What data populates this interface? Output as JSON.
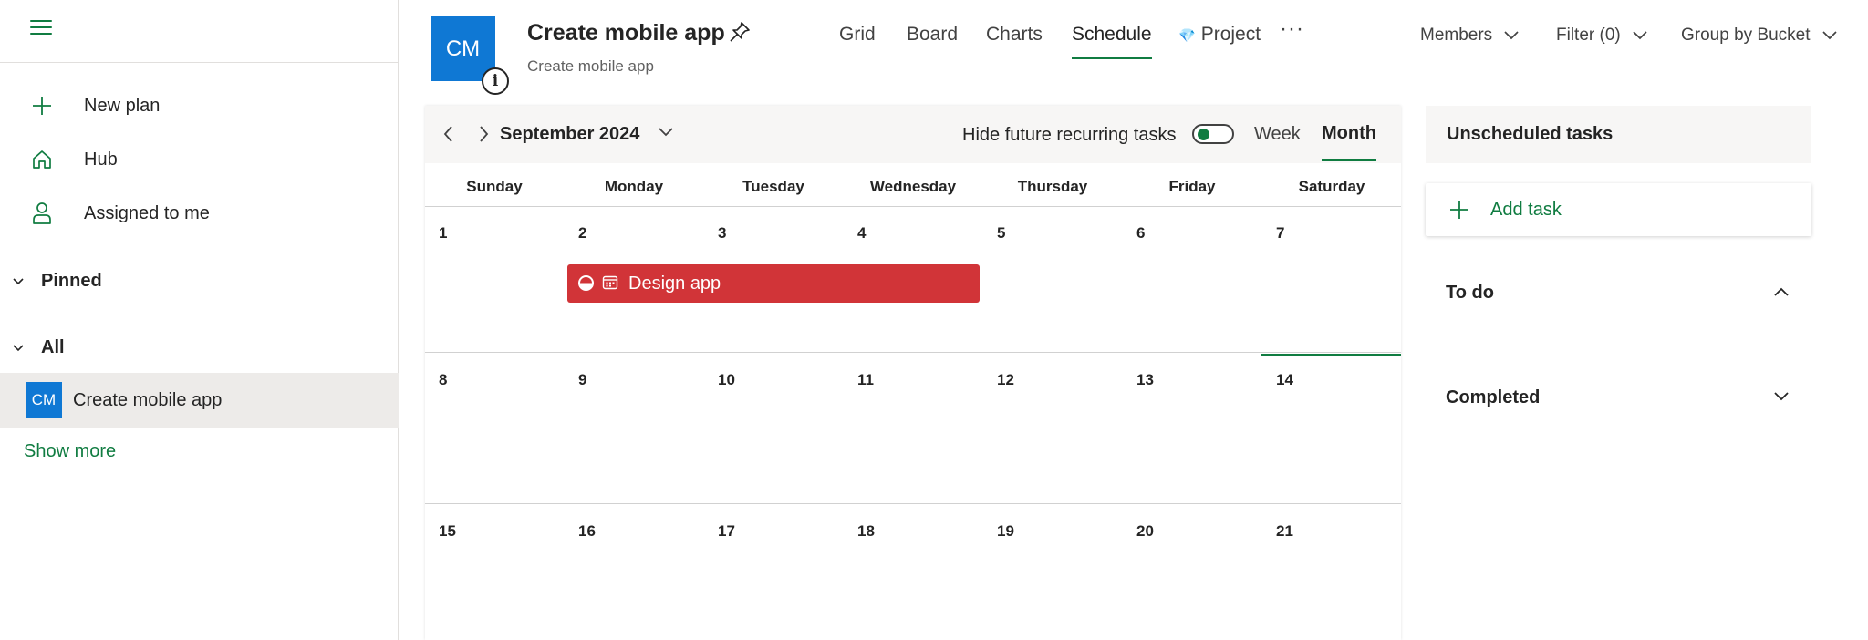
{
  "sidebar": {
    "menu_icon": "hamburger-menu-icon",
    "items": [
      {
        "label": "New plan",
        "icon": "plus-icon"
      },
      {
        "label": "Hub",
        "icon": "home-icon"
      },
      {
        "label": "Assigned to me",
        "icon": "person-icon"
      }
    ],
    "pinned_label": "Pinned",
    "all_label": "All",
    "plans": [
      {
        "initials": "CM",
        "label": "Create mobile app",
        "selected": true
      }
    ],
    "show_more": "Show more"
  },
  "header": {
    "plan_initials": "CM",
    "plan_title": "Create mobile app",
    "plan_subtitle": "Create mobile app",
    "tabs": [
      {
        "label": "Grid"
      },
      {
        "label": "Board"
      },
      {
        "label": "Charts"
      },
      {
        "label": "Schedule",
        "active": true
      },
      {
        "label": "Project",
        "icon": "diamond-icon"
      }
    ],
    "more": "···",
    "members_label": "Members",
    "filter_label": "Filter (0)",
    "group_label": "Group by Bucket"
  },
  "calendar": {
    "month_label": "September 2024",
    "hide_recurring_label": "Hide future recurring tasks",
    "hide_recurring_on": true,
    "view_week": "Week",
    "view_month": "Month",
    "active_view": "Month",
    "day_names": [
      "Sunday",
      "Monday",
      "Tuesday",
      "Wednesday",
      "Thursday",
      "Friday",
      "Saturday"
    ],
    "weeks": [
      [
        "1",
        "2",
        "3",
        "4",
        "5",
        "6",
        "7"
      ],
      [
        "8",
        "9",
        "10",
        "11",
        "12",
        "13",
        "14"
      ],
      [
        "15",
        "16",
        "17",
        "18",
        "19",
        "20",
        "21"
      ]
    ],
    "today": "14",
    "tasks": [
      {
        "label": "Design app",
        "start": "2",
        "end": "4",
        "progress": "in progress",
        "color": "#d13438"
      }
    ]
  },
  "unscheduled": {
    "title": "Unscheduled tasks",
    "add_task": "Add task",
    "buckets": [
      {
        "label": "To do",
        "expanded": true
      },
      {
        "label": "Completed",
        "expanded": false
      }
    ]
  },
  "colors": {
    "accent": "#107c41",
    "plan_blue": "#0f78d4",
    "task_red": "#d13438"
  }
}
